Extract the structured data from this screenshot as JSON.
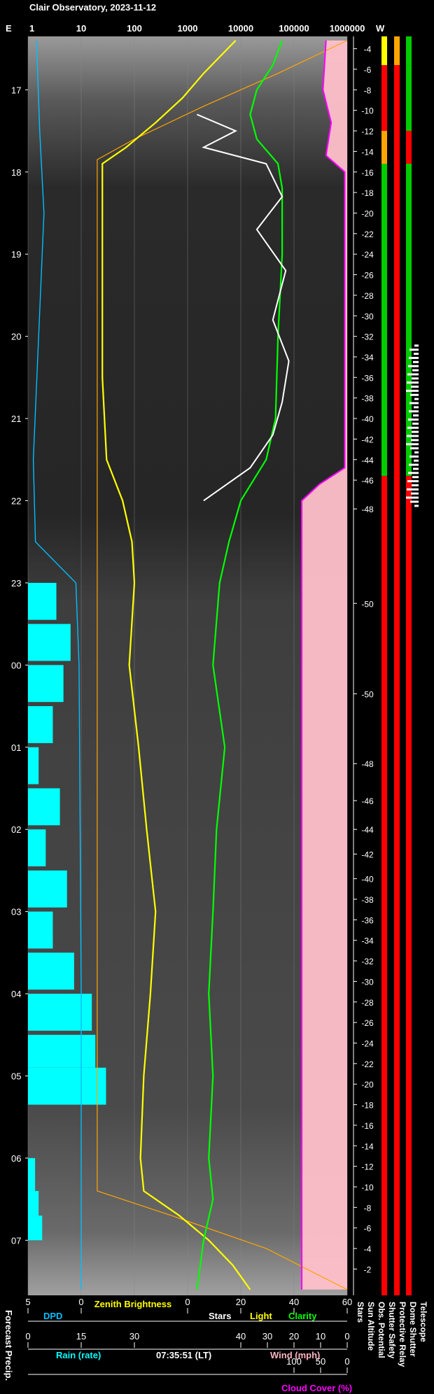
{
  "title": "Clair Observatory, 2023-11-12",
  "timestamp": "07:35:51 (LT)",
  "top_axis": {
    "left_label": "E",
    "right_label": "W",
    "ticks": [
      "1",
      "10",
      "100",
      "1000",
      "10000",
      "100000",
      "1000000"
    ]
  },
  "time_axis": {
    "labels": [
      "17",
      "18",
      "19",
      "20",
      "21",
      "22",
      "23",
      "00",
      "01",
      "02",
      "03",
      "04",
      "05",
      "06",
      "07"
    ],
    "hours_start": 16.35,
    "hours_end": 31.67
  },
  "sun_altitude": {
    "labels": [
      {
        "t": 16.5,
        "v": "-4"
      },
      {
        "t": 16.75,
        "v": "-6"
      },
      {
        "t": 17.0,
        "v": "-8"
      },
      {
        "t": 17.25,
        "v": "-10"
      },
      {
        "t": 17.5,
        "v": "-12"
      },
      {
        "t": 17.75,
        "v": "-14"
      },
      {
        "t": 18.0,
        "v": "-16"
      },
      {
        "t": 18.25,
        "v": "-18"
      },
      {
        "t": 18.5,
        "v": "-20"
      },
      {
        "t": 18.75,
        "v": "-22"
      },
      {
        "t": 19.0,
        "v": "-24"
      },
      {
        "t": 19.25,
        "v": "-26"
      },
      {
        "t": 19.5,
        "v": "-28"
      },
      {
        "t": 19.75,
        "v": "-30"
      },
      {
        "t": 20.0,
        "v": "-32"
      },
      {
        "t": 20.25,
        "v": "-34"
      },
      {
        "t": 20.5,
        "v": "-36"
      },
      {
        "t": 20.75,
        "v": "-38"
      },
      {
        "t": 21.0,
        "v": "-40"
      },
      {
        "t": 21.25,
        "v": "-42"
      },
      {
        "t": 21.5,
        "v": "-44"
      },
      {
        "t": 21.75,
        "v": "-46"
      },
      {
        "t": 22.1,
        "v": "-48"
      },
      {
        "t": 23.25,
        "v": "-50"
      },
      {
        "t": 24.35,
        "v": "-50"
      },
      {
        "t": 25.2,
        "v": "-48"
      },
      {
        "t": 25.65,
        "v": "-46"
      },
      {
        "t": 26.0,
        "v": "-44"
      },
      {
        "t": 26.3,
        "v": "-42"
      },
      {
        "t": 26.6,
        "v": "-40"
      },
      {
        "t": 26.85,
        "v": "-38"
      },
      {
        "t": 27.1,
        "v": "-36"
      },
      {
        "t": 27.35,
        "v": "-34"
      },
      {
        "t": 27.6,
        "v": "-32"
      },
      {
        "t": 27.85,
        "v": "-30"
      },
      {
        "t": 28.1,
        "v": "-28"
      },
      {
        "t": 28.35,
        "v": "-26"
      },
      {
        "t": 28.6,
        "v": "-24"
      },
      {
        "t": 28.85,
        "v": "-22"
      },
      {
        "t": 29.1,
        "v": "-20"
      },
      {
        "t": 29.35,
        "v": "-18"
      },
      {
        "t": 29.6,
        "v": "-16"
      },
      {
        "t": 29.85,
        "v": "-14"
      },
      {
        "t": 30.1,
        "v": "-12"
      },
      {
        "t": 30.35,
        "v": "-10"
      },
      {
        "t": 30.6,
        "v": "-8"
      },
      {
        "t": 30.85,
        "v": "-6"
      },
      {
        "t": 31.1,
        "v": "-4"
      },
      {
        "t": 31.35,
        "v": "-2"
      }
    ]
  },
  "bottom_axes": [
    {
      "name": "DPD",
      "color": "#00bfff",
      "ticks": [
        "5",
        "0"
      ]
    },
    {
      "name": "Zenith Brightness",
      "color": "#ffff00"
    },
    {
      "name": "Stars",
      "color": "#ffffff",
      "ticks": [
        "0",
        "20",
        "40",
        "60"
      ]
    },
    {
      "name": "Light",
      "color": "#ffff00"
    },
    {
      "name": "Clarity",
      "color": "#00ff00"
    },
    {
      "name": "Rain (rate)",
      "color": "#00ffff",
      "ticks": [
        "0",
        "15",
        "30"
      ]
    },
    {
      "name": "Wind (mph)",
      "color": "#ffb6c1",
      "ticks": [
        "40",
        "30",
        "20",
        "10",
        "0"
      ]
    },
    {
      "name": "Cloud Cover (%)",
      "color": "#ff00ff",
      "ticks": [
        "100",
        "50",
        "0"
      ]
    }
  ],
  "side_labels": {
    "forecast_precip": "Forecast Precip.",
    "columns": [
      "Stars",
      "Sun Altitude",
      "Obs. Potential",
      "Shutter Safety",
      "Protective Relay",
      "Dome Shutter",
      "Telescope"
    ]
  },
  "chart_data": {
    "type": "line",
    "x_unit": "hour (local time)",
    "y_axis_scale": "log",
    "series": [
      {
        "name": "Zenith Brightness",
        "color": "#ffff00",
        "t": [
          16.4,
          16.8,
          17.1,
          17.4,
          17.7,
          17.9,
          18.5,
          19.5,
          20.5,
          21.5,
          22.0,
          22.5,
          23.0,
          24.0,
          25.0,
          26.0,
          27.0,
          28.0,
          29.0,
          30.0,
          30.4,
          30.7,
          31.0,
          31.3,
          31.6
        ],
        "v": [
          8000,
          2000,
          800,
          250,
          70,
          25,
          25,
          25,
          25,
          30,
          60,
          90,
          100,
          80,
          120,
          170,
          250,
          200,
          150,
          130,
          150,
          700,
          2500,
          7000,
          15000
        ]
      },
      {
        "name": "Clarity",
        "color": "#00ff00",
        "t": [
          16.4,
          16.7,
          17.0,
          17.3,
          17.6,
          17.9,
          18.2,
          19.0,
          20.0,
          21.0,
          21.5,
          22.0,
          22.5,
          23.0,
          24.0,
          25.0,
          26.0,
          27.0,
          28.0,
          29.0,
          30.0,
          30.5,
          31.0,
          31.6
        ],
        "v": [
          60000,
          40000,
          20000,
          15000,
          20000,
          50000,
          60000,
          60000,
          50000,
          45000,
          30000,
          10000,
          6000,
          4000,
          3000,
          5000,
          3500,
          3000,
          2500,
          3000,
          2500,
          3000,
          2000,
          1500
        ]
      },
      {
        "name": "Stars",
        "color": "#ffffff",
        "t": [
          17.3,
          17.5,
          17.7,
          17.9,
          18.3,
          18.7,
          19.2,
          19.8,
          20.3,
          20.8,
          21.2,
          21.6,
          22.0
        ],
        "v": [
          1500,
          8000,
          2000,
          30000,
          60000,
          20000,
          70000,
          40000,
          80000,
          60000,
          40000,
          15000,
          2000
        ]
      },
      {
        "name": "Cloud Cover",
        "color": "#ff00ff",
        "t": [
          16.4,
          17.0,
          17.4,
          17.8,
          18.0,
          21.6,
          21.8,
          22.0,
          25.0,
          28.0,
          31.6
        ],
        "v": [
          400000,
          350000,
          500000,
          400000,
          900000,
          900000,
          300000,
          140000,
          140000,
          140000,
          140000
        ]
      },
      {
        "name": "Sun Altitude (model)",
        "color": "#ffa500",
        "t": [
          16.4,
          16.8,
          17.2,
          17.6,
          17.85,
          30.4,
          30.7,
          31.1,
          31.6
        ],
        "v": [
          1000000,
          50000,
          2000,
          100,
          20,
          20,
          500,
          30000,
          1000000
        ]
      },
      {
        "name": "Rain (rate)",
        "color": "#00ffff",
        "t": [
          23.0,
          23.5,
          24.0,
          24.5,
          25.0,
          25.5,
          26.0,
          26.5,
          27.0,
          27.5,
          28.0,
          28.5,
          28.9,
          30.0,
          30.4,
          30.7
        ],
        "v": [
          8,
          12,
          10,
          7,
          3,
          9,
          5,
          11,
          7,
          13,
          18,
          19,
          22,
          2,
          3,
          4
        ]
      },
      {
        "name": "DPD",
        "color": "#00bfff",
        "t": [
          16.4,
          17.5,
          18.5,
          20.0,
          21.5,
          22.5,
          23.0,
          24.0,
          28.0,
          31.6
        ],
        "v": [
          4.2,
          3.9,
          3.5,
          4.0,
          4.5,
          4.3,
          0.5,
          0.2,
          0.0,
          0.0
        ]
      }
    ],
    "status_bars": {
      "columns": [
        "Obs. Potential",
        "Shutter Safety",
        "Protective Relay"
      ],
      "segments": [
        {
          "t0": 16.35,
          "t1": 16.7,
          "colors": [
            "#ffff00",
            "#ffa500",
            "#00cc00"
          ]
        },
        {
          "t0": 16.7,
          "t1": 17.5,
          "colors": [
            "#ff0000",
            "#ff0000",
            "#00cc00"
          ]
        },
        {
          "t0": 17.5,
          "t1": 17.9,
          "colors": [
            "#ffa500",
            "#ff0000",
            "#ff0000"
          ]
        },
        {
          "t0": 17.9,
          "t1": 21.7,
          "colors": [
            "#00cc00",
            "#ff0000",
            "#00cc00"
          ]
        },
        {
          "t0": 21.7,
          "t1": 31.67,
          "colors": [
            "#ff0000",
            "#ff0000",
            "#ff0000"
          ]
        }
      ]
    }
  }
}
